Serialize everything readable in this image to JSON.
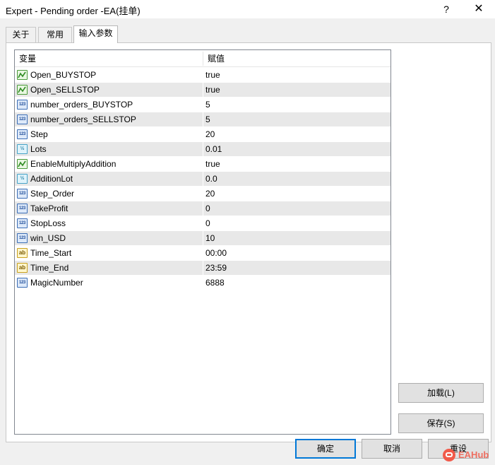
{
  "window": {
    "title": "Expert - Pending order -EA(挂单)",
    "help_label": "?",
    "close_label": "✕"
  },
  "tabs": [
    {
      "label": "关于",
      "active": false
    },
    {
      "label": "常用",
      "active": false
    },
    {
      "label": "输入参数",
      "active": true
    }
  ],
  "grid": {
    "columns": [
      "变量",
      "赋值"
    ],
    "rows": [
      {
        "name": "Open_BUYSTOP",
        "value": "true",
        "icon": "bool-icon"
      },
      {
        "name": "Open_SELLSTOP",
        "value": "true",
        "icon": "bool-icon"
      },
      {
        "name": "number_orders_BUYSTOP",
        "value": "5",
        "icon": "int-icon"
      },
      {
        "name": "number_orders_SELLSTOP",
        "value": "5",
        "icon": "int-icon"
      },
      {
        "name": "Step",
        "value": "20",
        "icon": "int-icon"
      },
      {
        "name": "Lots",
        "value": "0.01",
        "icon": "double-icon"
      },
      {
        "name": "EnableMultiplyAddition",
        "value": "true",
        "icon": "bool-icon"
      },
      {
        "name": "AdditionLot",
        "value": "0.0",
        "icon": "double-icon"
      },
      {
        "name": "Step_Order",
        "value": "20",
        "icon": "int-icon"
      },
      {
        "name": "TakeProfit",
        "value": "0",
        "icon": "int-icon"
      },
      {
        "name": "StopLoss",
        "value": "0",
        "icon": "int-icon"
      },
      {
        "name": "win_USD",
        "value": "10",
        "icon": "int-icon"
      },
      {
        "name": "Time_Start",
        "value": "00:00",
        "icon": "string-icon"
      },
      {
        "name": "Time_End",
        "value": "23:59",
        "icon": "string-icon"
      },
      {
        "name": "MagicNumber",
        "value": "6888",
        "icon": "int-icon"
      }
    ]
  },
  "icon_text": {
    "int": "123",
    "double": "½",
    "string": "ab"
  },
  "buttons": {
    "load": "加载(L)",
    "save": "保存(S)",
    "ok": "确定",
    "cancel": "取消",
    "reset": "重设"
  },
  "watermark": {
    "text": "EAHub"
  },
  "colors": {
    "accent": "#0078d7",
    "alt_row": "#e8e8e8",
    "watermark": "#f15a4a"
  }
}
